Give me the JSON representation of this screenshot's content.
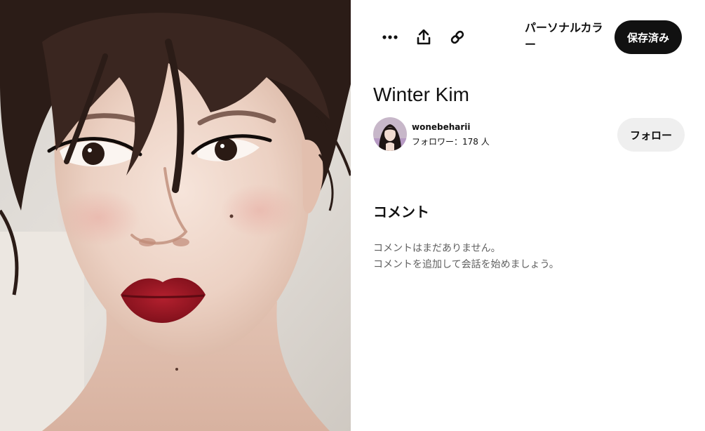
{
  "toolbar": {
    "more_icon": "ellipsis-icon",
    "share_icon": "share-upload-icon",
    "link_icon": "link-chain-icon",
    "board_name": "パーソナルカラー",
    "save_label": "保存済み"
  },
  "pin": {
    "title": "Winter Kim"
  },
  "creator": {
    "username": "wonebeharii",
    "followers": "フォロワー：178 人",
    "follow_label": "フォロー"
  },
  "comments": {
    "heading": "コメント",
    "empty_line1": "コメントはまだありません。",
    "empty_line2": "コメントを追加して会話を始めましょう。"
  },
  "colors": {
    "primary_dark": "#111111",
    "secondary_button": "#efefef",
    "muted_text": "#5f5f5f",
    "lip_red": "#9a1622"
  }
}
